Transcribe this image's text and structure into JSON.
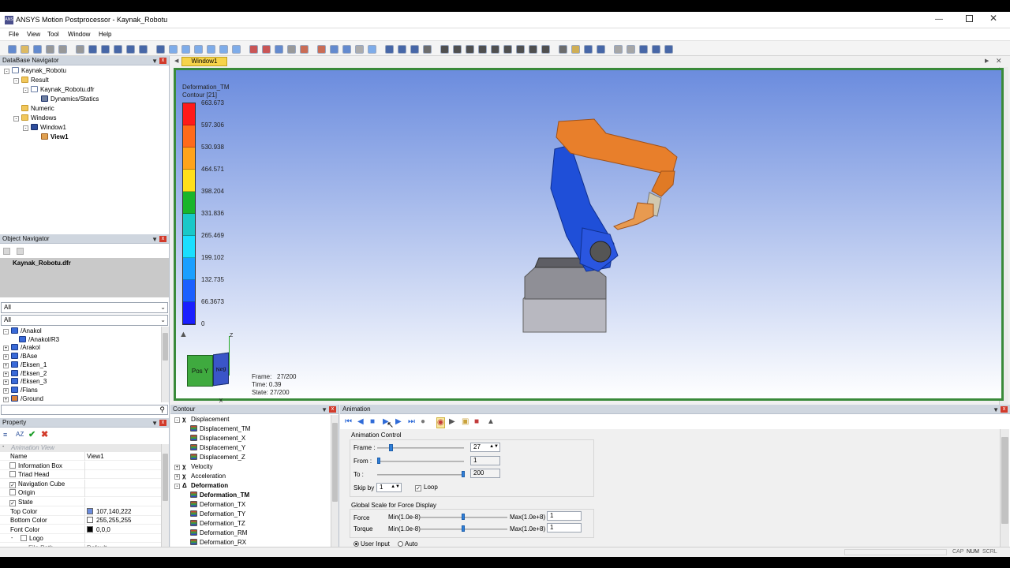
{
  "window": {
    "title": "ANSYS Motion Postprocessor - Kaynak_Robotu",
    "app_icon": "ansys-logo",
    "controls": [
      "minimize-icon",
      "maximize-icon",
      "close-icon"
    ]
  },
  "menu": [
    "File",
    "View",
    "Tool",
    "Window",
    "Help"
  ],
  "database_navigator": {
    "title": "DataBase Navigator",
    "tree": [
      {
        "label": "Kaynak_Robotu",
        "level": 0
      },
      {
        "label": "Result",
        "level": 1
      },
      {
        "label": "Kaynak_Robotu.dfr",
        "level": 2
      },
      {
        "label": "Dynamics/Statics",
        "level": 3
      },
      {
        "label": "Numeric",
        "level": 1
      },
      {
        "label": "Windows",
        "level": 1
      },
      {
        "label": "Window1",
        "level": 2
      },
      {
        "label": "View1",
        "level": 3
      }
    ]
  },
  "object_navigator": {
    "title": "Object Navigator",
    "selected": "Kaynak_Robotu.dfr",
    "filter1": "All",
    "filter2": "All",
    "items": [
      "/Anakol",
      "/Anakol/R3",
      "/Arakol",
      "/BAse",
      "/Eksen_1",
      "/Eksen_2",
      "/Eksen_3",
      "/Flans",
      "/Ground"
    ]
  },
  "property": {
    "title": "Property",
    "section": "Animation View",
    "rows": [
      {
        "name": "Name",
        "value": "View1",
        "check": ""
      },
      {
        "name": "Information Box",
        "value": "",
        "check": "off"
      },
      {
        "name": "Triad Head",
        "value": "",
        "check": "off"
      },
      {
        "name": "Navigation Cube",
        "value": "",
        "check": "on"
      },
      {
        "name": "Origin",
        "value": "",
        "check": "off"
      },
      {
        "name": "State",
        "value": "",
        "check": "on"
      },
      {
        "name": "Top Color",
        "value": "107,140,222",
        "check": ""
      },
      {
        "name": "Bottom Color",
        "value": "255,255,255",
        "check": ""
      },
      {
        "name": "Font Color",
        "value": "0,0,0",
        "check": ""
      },
      {
        "name": "Logo",
        "value": "",
        "check": "off"
      },
      {
        "name": "File Path",
        "value": "Default",
        "check": ""
      }
    ],
    "colors": {
      "top": "#6b8cde",
      "bottom": "#ffffff",
      "font": "#000000"
    }
  },
  "viewport": {
    "tab": "Window1",
    "legend_title": "Deformation_TM",
    "legend_subtitle": "Contour [21]",
    "legend_values": [
      "663.673",
      "597.306",
      "530.938",
      "464.571",
      "398.204",
      "331.836",
      "265.469",
      "199.102",
      "132.735",
      "66.3673",
      "0"
    ],
    "cube_pos": "Pos Y",
    "cube_neg": "Neg X",
    "axis_z": "Z",
    "frame_text": "Frame:   27/200",
    "time_text": "Time: 0.39",
    "state_text": "State: 27/200"
  },
  "contour": {
    "title": "Contour",
    "tree": [
      {
        "label": "Displacement",
        "level": 0,
        "bold": false
      },
      {
        "label": "Displacement_TM",
        "level": 1,
        "bold": false
      },
      {
        "label": "Displacement_X",
        "level": 1,
        "bold": false
      },
      {
        "label": "Displacement_Y",
        "level": 1,
        "bold": false
      },
      {
        "label": "Displacement_Z",
        "level": 1,
        "bold": false
      },
      {
        "label": "Velocity",
        "level": 0,
        "bold": false
      },
      {
        "label": "Acceleration",
        "level": 0,
        "bold": false
      },
      {
        "label": "Deformation",
        "level": 0,
        "bold": true
      },
      {
        "label": "Deformation_TM",
        "level": 1,
        "bold": true
      },
      {
        "label": "Deformation_TX",
        "level": 1,
        "bold": false
      },
      {
        "label": "Deformation_TY",
        "level": 1,
        "bold": false
      },
      {
        "label": "Deformation_TZ",
        "level": 1,
        "bold": false
      },
      {
        "label": "Deformation_RM",
        "level": 1,
        "bold": false
      },
      {
        "label": "Deformation_RX",
        "level": 1,
        "bold": false
      }
    ]
  },
  "animation": {
    "title": "Animation",
    "control_group": "Animation Control",
    "frame_label": "Frame :",
    "frame_value": "27",
    "frame_fraction": 0.135,
    "from_label": "From :",
    "from_value": "1",
    "to_label": "To :",
    "to_value": "200",
    "skip_label": "Skip by :",
    "skip_value": "1",
    "loop_label": "Loop",
    "scale_group": "Global Scale for Force Display",
    "force_label": "Force",
    "torque_label": "Torque",
    "min_label": "Min(1.0e-8)",
    "max_label": "Max(1.0e+8)",
    "force_value": "1",
    "torque_value": "1",
    "user_input": "User Input",
    "auto": "Auto"
  },
  "status": {
    "items": [
      "CAP",
      "NUM",
      "SCRL"
    ]
  }
}
